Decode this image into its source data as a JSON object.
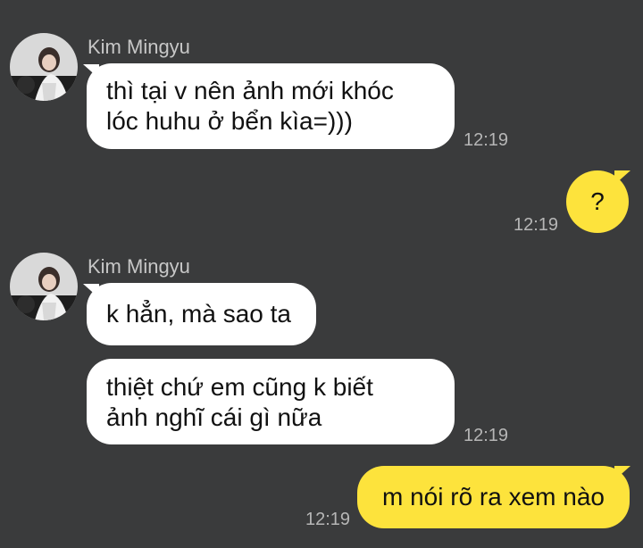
{
  "chat": {
    "messages": [
      {
        "sender": "Kim Mingyu",
        "text": "thì tại v nên ảnh mới khóc\nlóc huhu ở bển kìa=)))",
        "time": "12:19"
      },
      {
        "sender": "me",
        "text": "?",
        "time": "12:19"
      },
      {
        "sender": "Kim Mingyu",
        "text": "k hẳn, mà sao ta",
        "time": ""
      },
      {
        "sender": "Kim Mingyu",
        "text": "thiệt chứ em cũng k biết\nảnh nghĩ cái gì nữa",
        "time": "12:19"
      },
      {
        "sender": "me",
        "text": "m nói rõ ra xem nào",
        "time": "12:19"
      }
    ]
  },
  "colors": {
    "background": "#3a3b3c",
    "incoming_bubble": "#ffffff",
    "outgoing_bubble": "#fde33c",
    "sender_name": "#c7c7c7",
    "timestamp": "#b6b6b6"
  },
  "icons": {
    "avatar": "profile-photo"
  }
}
